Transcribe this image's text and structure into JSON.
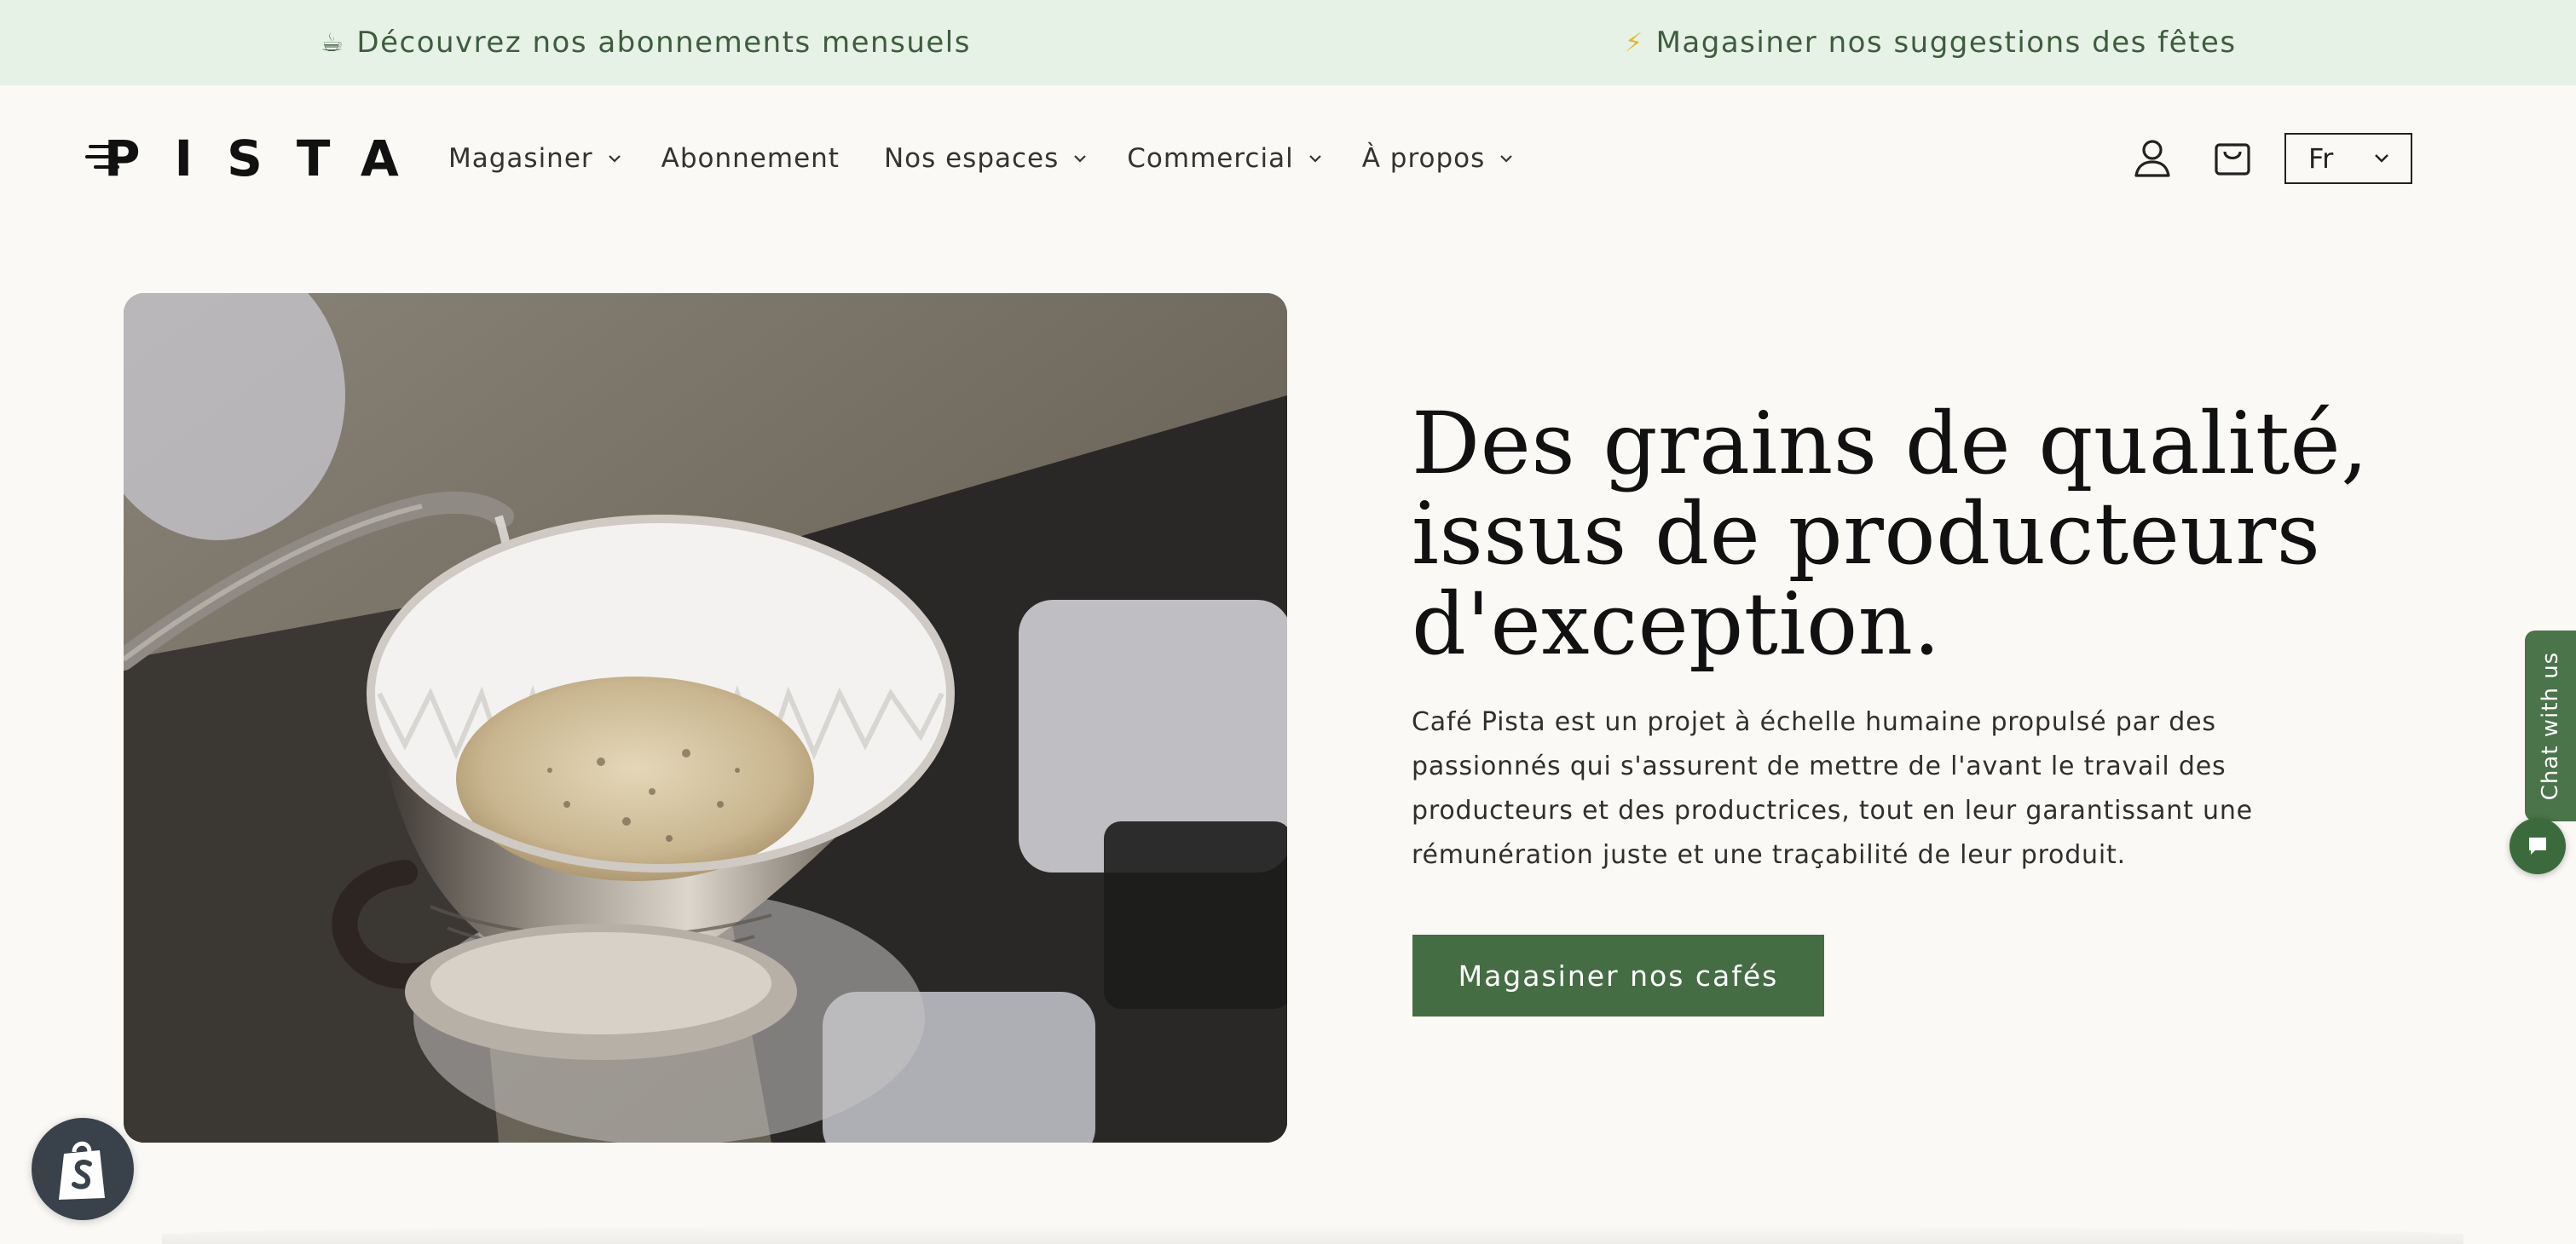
{
  "announcements": {
    "left": {
      "icon": "coffee-cup-icon",
      "emoji": "☕",
      "text": "Découvrez nos abonnements mensuels"
    },
    "right": {
      "icon": "lightning-bolt-icon",
      "emoji": "⚡",
      "text": "Magasiner nos suggestions des fêtes"
    }
  },
  "header": {
    "logo_text": "PISTA",
    "nav": [
      {
        "label": "Magasiner",
        "has_dropdown": true
      },
      {
        "label": "Abonnement",
        "has_dropdown": false
      },
      {
        "label": "Nos espaces",
        "has_dropdown": true
      },
      {
        "label": "Commercial",
        "has_dropdown": true
      },
      {
        "label": "À propos",
        "has_dropdown": true
      }
    ],
    "account_icon": "user-icon",
    "cart_icon": "shopping-bag-icon",
    "language": {
      "selected": "Fr"
    }
  },
  "hero": {
    "image_alt": "pour-over-coffee-dripper",
    "title": "Des grains de qualité, issus de producteurs d'exception.",
    "body": "Café Pista est un projet à échelle humaine propulsé par des passionnés qui s'assurent de mettre de l'avant le travail des producteurs et des productrices, tout en leur garantissant une rémunération juste et une traçabilité de leur produit.",
    "button": "Magasiner nos cafés"
  },
  "chat": {
    "tab_label": "Chat with us",
    "bubble_icon": "chat-bubble-icon"
  },
  "shopify_badge_icon": "shopify-bag-icon",
  "colors": {
    "announcement_bg": "#e7f2e6",
    "page_bg": "#faf9f5",
    "accent_green": "#456d43"
  }
}
